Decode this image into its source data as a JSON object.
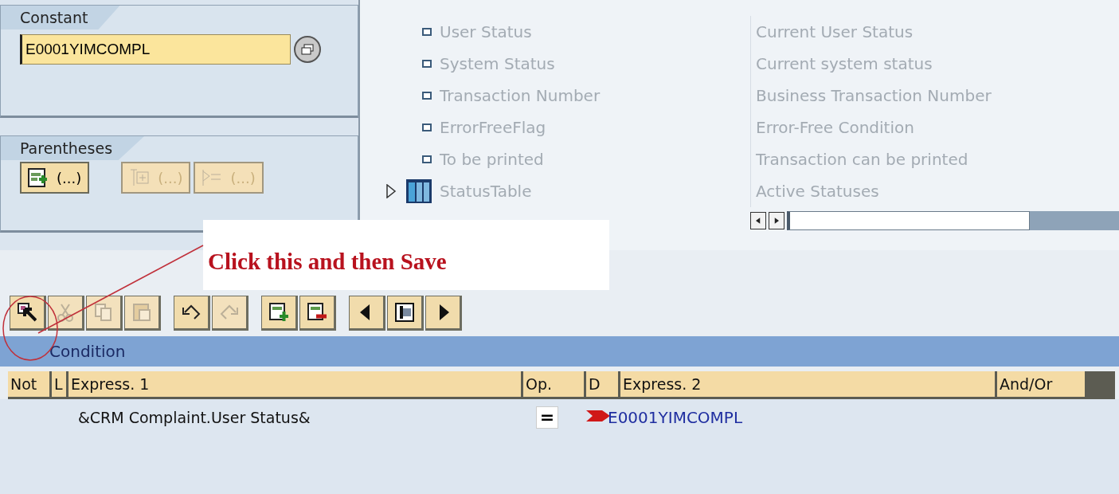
{
  "constant": {
    "title": "Constant",
    "value": "E0001YIMCOMPL"
  },
  "parentheses": {
    "title": "Parentheses",
    "buttons": [
      {
        "kind": "insert",
        "label": "(...)",
        "disabled": false
      },
      {
        "kind": "remove",
        "label": "(...)",
        "disabled": true
      },
      {
        "kind": "outdent",
        "label": "(...)",
        "disabled": true
      }
    ]
  },
  "tree": {
    "rows": [
      {
        "kind": "field",
        "label": "User Status",
        "description": "Current User Status"
      },
      {
        "kind": "field",
        "label": "System Status",
        "description": "Current system status"
      },
      {
        "kind": "field",
        "label": "Transaction Number",
        "description": "Business Transaction Number"
      },
      {
        "kind": "field",
        "label": "ErrorFreeFlag",
        "description": "Error-Free Condition"
      },
      {
        "kind": "field",
        "label": "To be printed",
        "description": "Transaction can be printed"
      },
      {
        "kind": "table",
        "label": "StatusTable",
        "description": "Active Statuses",
        "expanded": false
      }
    ]
  },
  "annotation": {
    "text": "Click this and then Save"
  },
  "toolbar": [
    [
      {
        "kind": "select",
        "disabled": false
      },
      {
        "kind": "cut",
        "disabled": true
      },
      {
        "kind": "copy",
        "disabled": true
      },
      {
        "kind": "paste",
        "disabled": true
      }
    ],
    [
      {
        "kind": "undo",
        "disabled": false
      },
      {
        "kind": "redo",
        "disabled": true
      }
    ],
    [
      {
        "kind": "add-row",
        "disabled": false
      },
      {
        "kind": "delete-row",
        "disabled": false
      }
    ],
    [
      {
        "kind": "left",
        "disabled": false
      },
      {
        "kind": "fit",
        "disabled": false
      },
      {
        "kind": "right",
        "disabled": false
      }
    ]
  ],
  "condition": {
    "title": "Condition",
    "columns": [
      "Not",
      "L",
      "Express. 1",
      "Op.",
      "D",
      "Express. 2",
      "And/Or"
    ],
    "rows": [
      {
        "express_1": "&CRM Complaint.User Status&",
        "operator": "=",
        "express_2": "E0001YIMCOMPL"
      }
    ]
  }
}
